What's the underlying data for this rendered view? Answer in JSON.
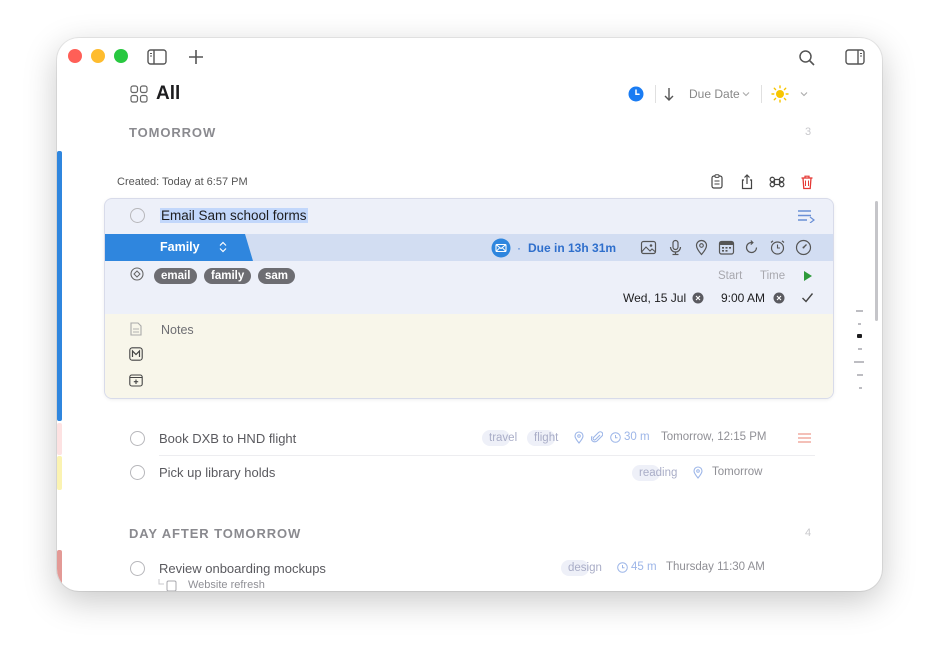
{
  "window": {
    "colors": {
      "close": "#ff5f57",
      "minimize": "#febc2e",
      "zoom": "#28c840",
      "accent": "#2f86de",
      "notes_bg": "#f8f6ea",
      "delete": "#e53935"
    }
  },
  "header": {
    "title": "All",
    "sort_label": "Due Date",
    "icons": [
      "grid-icon",
      "clock-icon",
      "arrow-down-icon",
      "sun-icon",
      "chevron-down-icon"
    ]
  },
  "sections": [
    {
      "title": "TOMORROW",
      "count": "3"
    },
    {
      "title": "DAY AFTER TOMORROW",
      "count": "4"
    }
  ],
  "editor": {
    "created_label": "Created: Today at 6:57 PM",
    "task_title": "Email Sam school forms",
    "list_name": "Family",
    "due_text": "Due in 13h 31m",
    "tags": [
      "email",
      "family",
      "sam"
    ],
    "start_label": "Start",
    "time_label": "Time",
    "date_value": "Wed, 15 Jul",
    "time_value": "9:00 AM",
    "notes_placeholder": "Notes"
  },
  "tasks": [
    {
      "title": "Book DXB to HND flight",
      "tags": [
        "travel",
        "flight"
      ],
      "duration": "30 m",
      "when": "Tomorrow, 12:15 PM"
    },
    {
      "title": "Pick up library holds",
      "tags": [
        "reading"
      ],
      "when": "Tomorrow"
    },
    {
      "title": "Review onboarding mockups",
      "tags": [
        "design"
      ],
      "duration": "45 m",
      "when": "Thursday 11:30 AM",
      "subtitle": "Website refresh"
    }
  ]
}
